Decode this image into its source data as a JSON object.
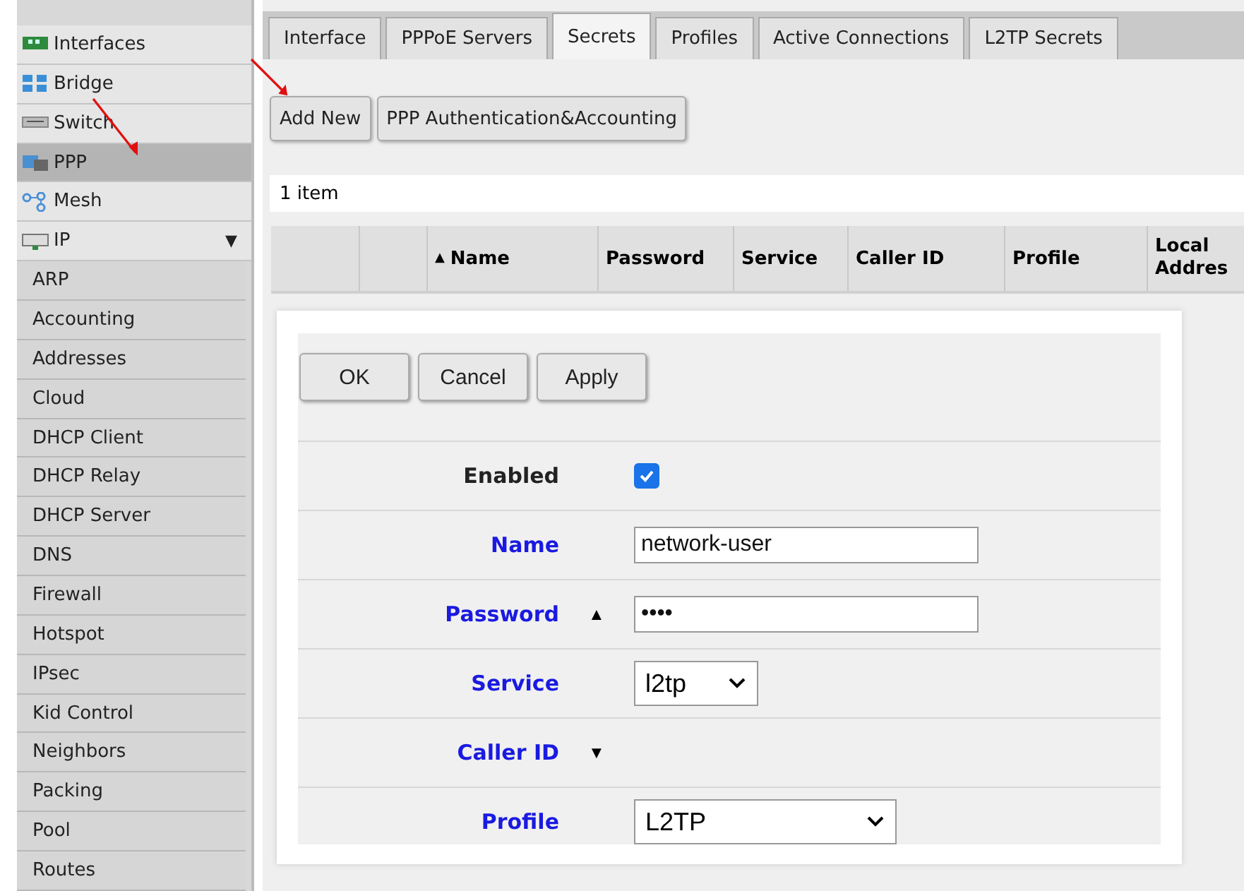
{
  "sidebar": {
    "items": [
      {
        "label": "Interfaces",
        "selected": false
      },
      {
        "label": "Bridge",
        "selected": false
      },
      {
        "label": "Switch",
        "selected": false
      },
      {
        "label": "PPP",
        "selected": true
      },
      {
        "label": "Mesh",
        "selected": false
      },
      {
        "label": "IP",
        "selected": false,
        "expanded": true,
        "toggle": "▼",
        "children": [
          {
            "label": "ARP"
          },
          {
            "label": "Accounting"
          },
          {
            "label": "Addresses"
          },
          {
            "label": "Cloud"
          },
          {
            "label": "DHCP Client"
          },
          {
            "label": "DHCP Relay"
          },
          {
            "label": "DHCP Server"
          },
          {
            "label": "DNS"
          },
          {
            "label": "Firewall"
          },
          {
            "label": "Hotspot"
          },
          {
            "label": "IPsec"
          },
          {
            "label": "Kid Control"
          },
          {
            "label": "Neighbors"
          },
          {
            "label": "Packing"
          },
          {
            "label": "Pool"
          },
          {
            "label": "Routes"
          }
        ]
      }
    ]
  },
  "tabs": [
    {
      "label": "Interface",
      "selected": false
    },
    {
      "label": "PPPoE Servers",
      "selected": false
    },
    {
      "label": "Secrets",
      "selected": true
    },
    {
      "label": "Profiles",
      "selected": false
    },
    {
      "label": "Active Connections",
      "selected": false
    },
    {
      "label": "L2TP Secrets",
      "selected": false
    }
  ],
  "toolbar": {
    "buttons": [
      "Add New",
      "PPP Authentication&Accounting"
    ]
  },
  "item_count": "1 item",
  "table": {
    "columns": [
      {
        "label": "Name",
        "sort": "▲"
      },
      {
        "label": "Password"
      },
      {
        "label": "Service"
      },
      {
        "label": "Caller ID"
      },
      {
        "label": "Profile"
      },
      {
        "label": "Local Addres"
      }
    ]
  },
  "dialog": {
    "buttons": [
      "OK",
      "Cancel",
      "Apply"
    ],
    "fields": [
      {
        "kind": "checkbox",
        "label": "Enabled",
        "modified": false,
        "checked": true
      },
      {
        "kind": "text",
        "label": "Name",
        "modified": true,
        "value": "network-user"
      },
      {
        "kind": "password",
        "label": "Password",
        "modified": true,
        "toggle": "▲",
        "value": "••••"
      },
      {
        "kind": "select",
        "label": "Service",
        "modified": true,
        "value": "l2tp"
      },
      {
        "kind": "collapsed",
        "label": "Caller ID",
        "modified": true,
        "toggle": "▼"
      },
      {
        "kind": "select-wide",
        "label": "Profile",
        "modified": true,
        "value": "L2TP"
      }
    ]
  },
  "annotations": [
    {
      "kind": "arrow"
    },
    {
      "kind": "arrow"
    }
  ]
}
